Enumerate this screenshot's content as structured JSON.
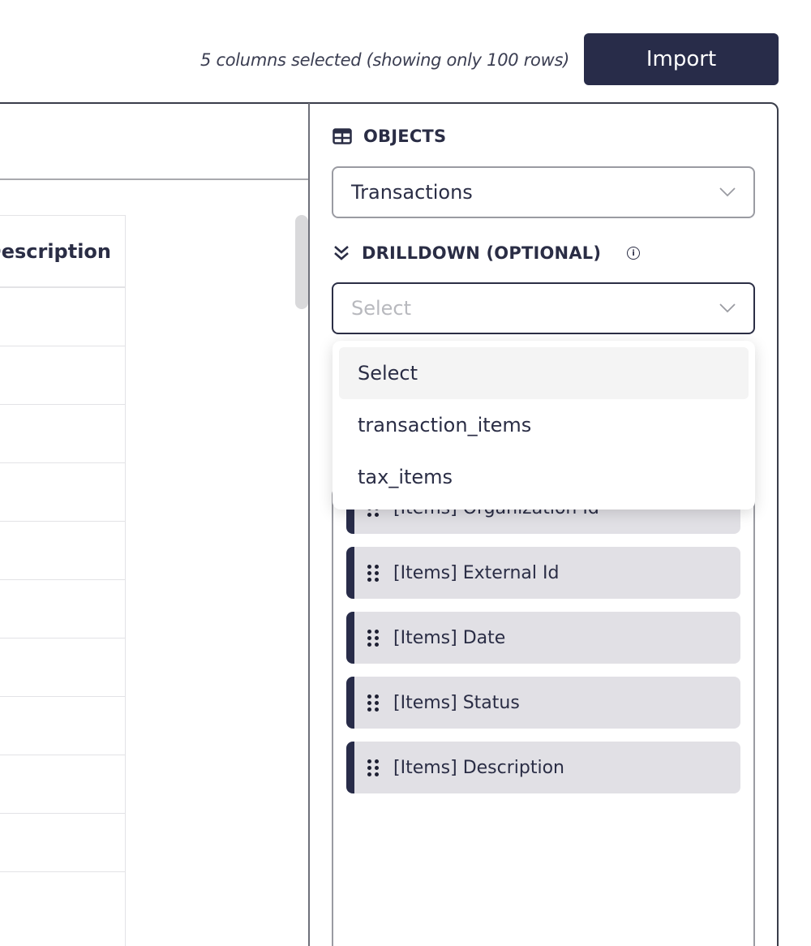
{
  "header": {
    "status_text": "5 columns selected (showing only 100 rows)",
    "import_label": "Import"
  },
  "table": {
    "column_header": "Description",
    "row_count_visible": 11
  },
  "panel": {
    "objects_title": "OBJECTS",
    "objects_value": "Transactions",
    "drilldown_title": "DRILLDOWN (OPTIONAL)",
    "drilldown_placeholder": "Select",
    "drilldown_options": [
      "Select",
      "transaction_items",
      "tax_items"
    ],
    "drilldown_highlighted": "Select",
    "selected_columns": [
      "[Items] Organization Id",
      "[Items] External Id",
      "[Items] Date",
      "[Items] Status",
      "[Items] Description"
    ]
  },
  "icons": {
    "objects": "table-icon",
    "drilldown": "double-chevron-down-icon",
    "info": "info-icon",
    "select_caret": "chevron-down-icon",
    "drag": "drag-handle-icon"
  },
  "colors": {
    "primary": "#282c49",
    "item_bg": "#e1e0e5",
    "border": "#9a9ba2"
  }
}
